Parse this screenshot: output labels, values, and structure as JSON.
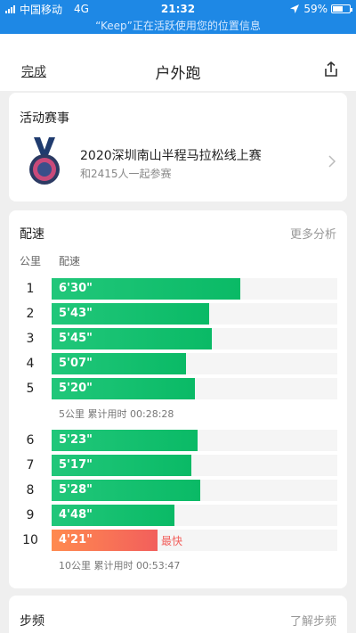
{
  "status_bar": {
    "carrier": "中国移动",
    "network": "4G",
    "time": "21:32",
    "battery": "59%",
    "battery_level": 0.59
  },
  "location_banner": "“Keep”正在活跃使用您的位置信息",
  "nav": {
    "done": "完成",
    "title": "户外跑",
    "share_icon": "share-icon"
  },
  "events": {
    "title": "活动赛事",
    "name": "2020深圳南山半程马拉松线上赛",
    "participants": "和2415人一起参赛",
    "medal_icon": "medal-icon"
  },
  "pace": {
    "title": "配速",
    "more": "更多分析",
    "col_km": "公里",
    "col_pace": "配速",
    "fastest_label": "最快",
    "rows": [
      {
        "km": "1",
        "pace": "6'30\"",
        "fraction": 0.66
      },
      {
        "km": "2",
        "pace": "5'43\"",
        "fraction": 0.55
      },
      {
        "km": "3",
        "pace": "5'45\"",
        "fraction": 0.56
      },
      {
        "km": "4",
        "pace": "5'07\"",
        "fraction": 0.47
      },
      {
        "km": "5",
        "pace": "5'20\"",
        "fraction": 0.5
      },
      {
        "km": "6",
        "pace": "5'23\"",
        "fraction": 0.51
      },
      {
        "km": "7",
        "pace": "5'17\"",
        "fraction": 0.49
      },
      {
        "km": "8",
        "pace": "5'28\"",
        "fraction": 0.52
      },
      {
        "km": "9",
        "pace": "4'48\"",
        "fraction": 0.43
      },
      {
        "km": "10",
        "pace": "4'21\"",
        "fraction": 0.37,
        "fastest": true
      }
    ],
    "summary_5": "5公里 累计用时 00:28:28",
    "summary_10": "10公里 累计用时 00:53:47"
  },
  "cadence": {
    "title": "步频",
    "more": "了解步频"
  },
  "colors": {
    "accent": "#1e88e5",
    "bar_green": "#0aba66",
    "fastest": "#f25f5c"
  }
}
